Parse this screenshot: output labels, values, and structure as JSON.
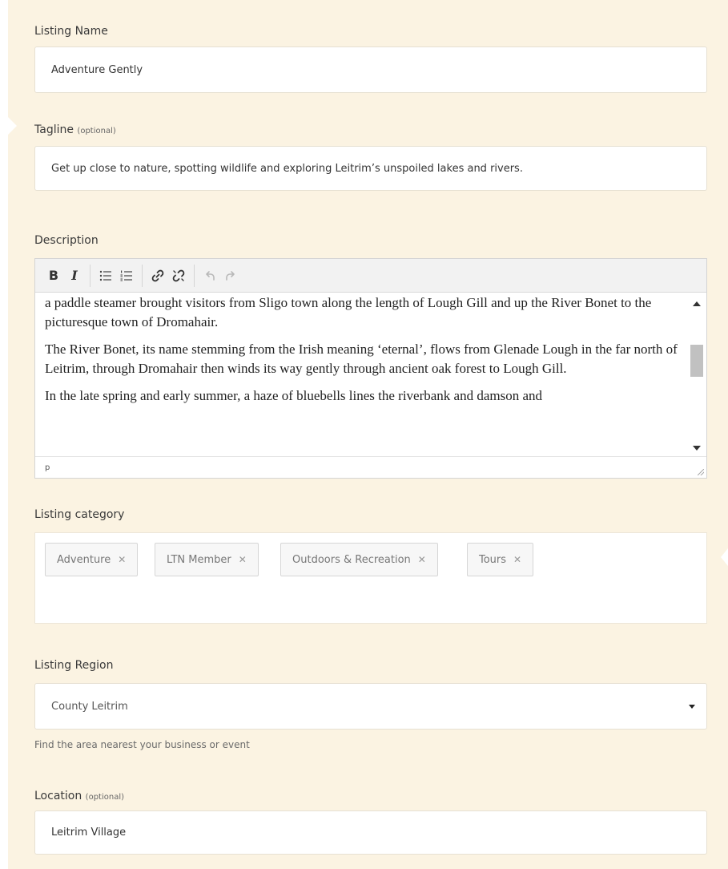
{
  "listing_name": {
    "label": "Listing Name",
    "value": "Adventure Gently"
  },
  "tagline": {
    "label": "Tagline",
    "optional": "(optional)",
    "value": "Get up close to nature, spotting wildlife and exploring Leitrim’s unspoiled lakes and rivers."
  },
  "description": {
    "label": "Description",
    "toolbar": {
      "bold": "B",
      "italic": "I",
      "bullets_icon": "bullet-list-icon",
      "numbers_icon": "numbered-list-icon",
      "link_icon": "link-icon",
      "unlink_icon": "unlink-icon",
      "undo_icon": "undo-icon",
      "redo_icon": "redo-icon"
    },
    "paragraphs": [
      "a paddle steamer brought visitors from Sligo town along the length of Lough Gill and up the River Bonet to the picturesque town of Dromahair.",
      "The River Bonet, its name stemming from the Irish meaning ‘eternal’, flows from Glenade Lough in the far north of Leitrim, through Dromahair then winds its way gently through ancient oak forest to Lough Gill.",
      "In the late spring and early summer, a haze of bluebells lines the riverbank and damson and"
    ],
    "status_path": "p"
  },
  "listing_category": {
    "label": "Listing category",
    "tags": [
      "Adventure",
      "LTN Member",
      "Outdoors & Recreation",
      "Tours"
    ],
    "remove_glyph": "✕"
  },
  "listing_region": {
    "label": "Listing Region",
    "selected": "County Leitrim",
    "help": "Find the area nearest your business or event"
  },
  "location": {
    "label": "Location",
    "optional": "(optional)",
    "value": "Leitrim Village"
  },
  "colors": {
    "panel_bg": "#fbf3e2",
    "field_bg": "#ffffff",
    "tag_bg": "#f7f7f7"
  }
}
